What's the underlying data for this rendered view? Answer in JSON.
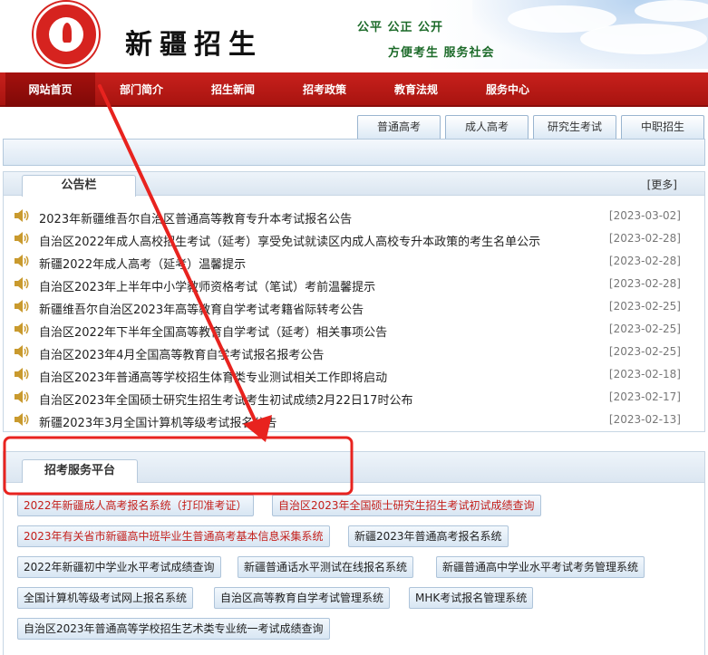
{
  "header": {
    "site_title": "新疆招生",
    "slogan_line1": "公平  公正  公开",
    "slogan_line2": "方便考生    服务社会"
  },
  "nav": {
    "items": [
      {
        "label": "网站首页",
        "active": true
      },
      {
        "label": "部门简介"
      },
      {
        "label": "招生新闻"
      },
      {
        "label": "招考政策"
      },
      {
        "label": "教育法规"
      },
      {
        "label": "服务中心"
      }
    ]
  },
  "subtabs": [
    "普通高考",
    "成人高考",
    "研究生考试",
    "中职招生"
  ],
  "notice": {
    "title": "公告栏",
    "more": "[更多]",
    "items": [
      {
        "title": "2023年新疆维吾尔自治区普通高等教育专升本考试报名公告",
        "date": "[2023-03-02]"
      },
      {
        "title": "自治区2022年成人高校招生考试（延考）享受免试就读区内成人高校专升本政策的考生名单公示",
        "date": "[2023-02-28]"
      },
      {
        "title": "新疆2022年成人高考（延考）温馨提示",
        "date": "[2023-02-28]"
      },
      {
        "title": "自治区2023年上半年中小学教师资格考试（笔试）考前温馨提示",
        "date": "[2023-02-28]"
      },
      {
        "title": "新疆维吾尔自治区2023年高等教育自学考试考籍省际转考公告",
        "date": "[2023-02-25]"
      },
      {
        "title": "自治区2022年下半年全国高等教育自学考试（延考）相关事项公告",
        "date": "[2023-02-25]"
      },
      {
        "title": "自治区2023年4月全国高等教育自学考试报名报考公告",
        "date": "[2023-02-25]"
      },
      {
        "title": "自治区2023年普通高等学校招生体育类专业测试相关工作即将启动",
        "date": "[2023-02-18]"
      },
      {
        "title": "自治区2023年全国硕士研究生招生考试考生初试成绩2月22日17时公布",
        "date": "[2023-02-17]"
      },
      {
        "title": "新疆2023年3月全国计算机等级考试报名公告",
        "date": "[2023-02-13]"
      }
    ]
  },
  "service": {
    "title": "招考服务平台",
    "buttons": [
      {
        "label": "2022年新疆成人高考报名系统（打印准考证）",
        "red": true
      },
      {
        "label": "自治区2023年全国硕士研究生招生考试初试成绩查询",
        "red": true
      },
      {
        "label": "2023年有关省市新疆高中班毕业生普通高考基本信息采集系统",
        "red": true
      },
      {
        "label": "新疆2023年普通高考报名系统"
      },
      {
        "label": "2022年新疆初中学业水平考试成绩查询"
      },
      {
        "label": "新疆普通话水平测试在线报名系统"
      },
      {
        "label": "新疆普通高中学业水平考试考务管理系统"
      },
      {
        "label": "全国计算机等级考试网上报名系统"
      },
      {
        "label": "自治区高等教育自学考试管理系统"
      },
      {
        "label": "MHK考试报名管理系统"
      },
      {
        "label": "自治区2023年普通高等学校招生艺术类专业统一考试成绩查询"
      }
    ]
  },
  "colors": {
    "nav_red": "#c8201c",
    "annotation_red": "#e8231f",
    "slogan_green": "#1d6b2a"
  }
}
